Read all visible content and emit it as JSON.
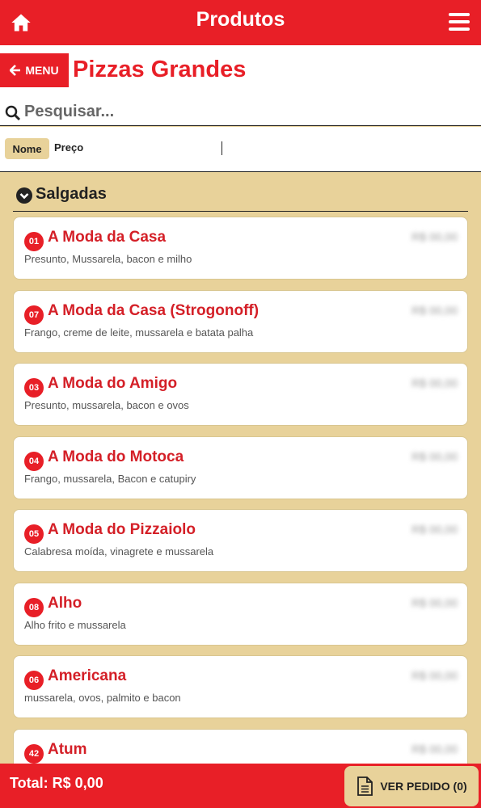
{
  "topbar": {
    "title": "Produtos",
    "home_icon": "home-icon",
    "menu_icon": "hamburger-icon"
  },
  "header": {
    "menu_label": "MENU",
    "page_title": "Pizzas Grandes"
  },
  "search": {
    "placeholder": "Pesquisar..."
  },
  "sort": {
    "nome": "Nome",
    "preco": "Preço"
  },
  "category": {
    "label": "Salgadas"
  },
  "items": [
    {
      "num": "01",
      "name": "A Moda da Casa",
      "desc": "Presunto, Mussarela, bacon e milho",
      "price": "R$ 00,00"
    },
    {
      "num": "07",
      "name": "A Moda da Casa (Strogonoff)",
      "desc": "Frango, creme de leite, mussarela e batata palha",
      "price": "R$ 00,00"
    },
    {
      "num": "03",
      "name": "A Moda do Amigo",
      "desc": "Presunto, mussarela, bacon e ovos",
      "price": "R$ 00,00"
    },
    {
      "num": "04",
      "name": "A Moda do Motoca",
      "desc": "Frango, mussarela, Bacon e catupiry",
      "price": "R$ 00,00"
    },
    {
      "num": "05",
      "name": "A Moda do Pizzaiolo",
      "desc": "Calabresa moída, vinagrete e mussarela",
      "price": "R$ 00,00"
    },
    {
      "num": "08",
      "name": "Alho",
      "desc": "Alho frito e mussarela",
      "price": "R$ 00,00"
    },
    {
      "num": "06",
      "name": "Americana",
      "desc": "mussarela, ovos, palmito e bacon",
      "price": "R$ 00,00"
    },
    {
      "num": "42",
      "name": "Atum",
      "desc": "",
      "price": "R$ 00,00"
    }
  ],
  "footer": {
    "total": "Total: R$ 0,00",
    "order_label": "VER PEDIDO (0)"
  },
  "colors": {
    "primary": "#e81f27",
    "beige": "#e8d29a"
  }
}
